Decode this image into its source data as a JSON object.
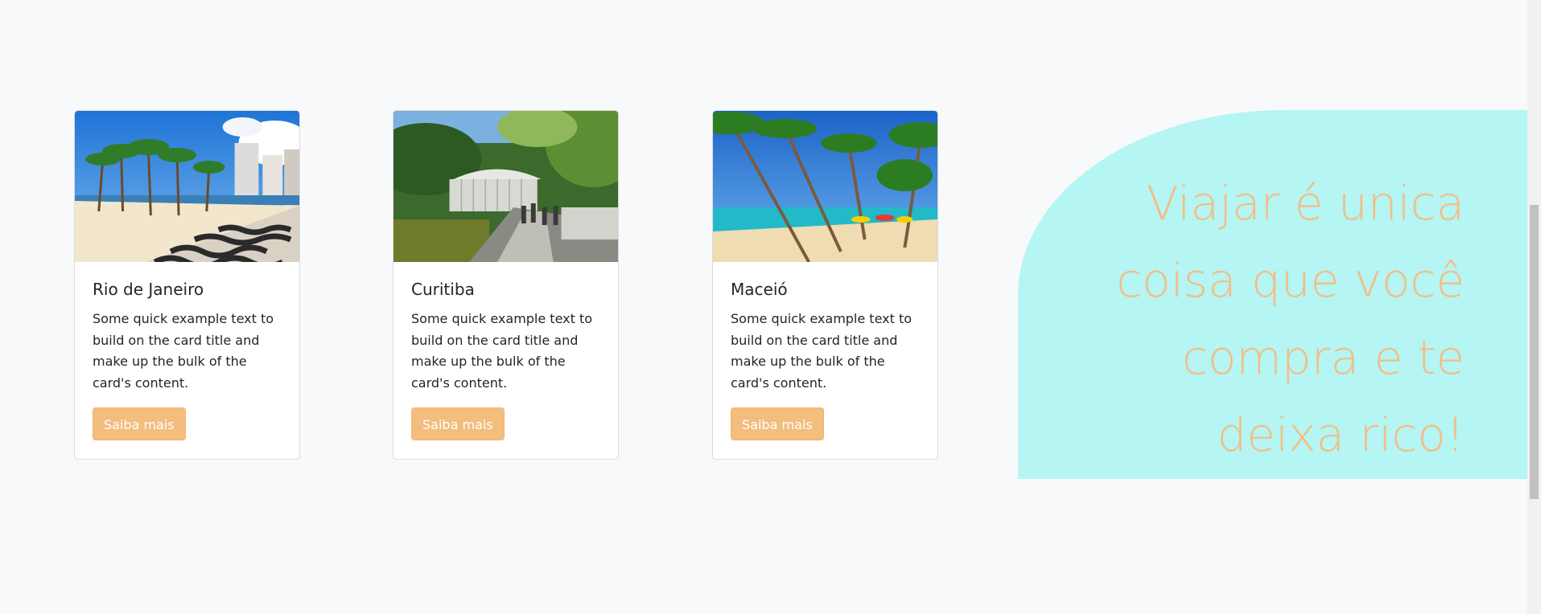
{
  "cards": [
    {
      "title": "Rio de Janeiro",
      "text": "Some quick example text to build on the card title and make up the bulk of the card's content.",
      "button_label": "Saiba mais",
      "image_alt": "Copacabana beach promenade with palm trees"
    },
    {
      "title": "Curitiba",
      "text": "Some quick example text to build on the card title and make up the bulk of the card's content.",
      "button_label": "Saiba mais",
      "image_alt": "Glass pavilion and bridge among forest"
    },
    {
      "title": "Maceió",
      "text": "Some quick example text to build on the card title and make up the bulk of the card's content.",
      "button_label": "Saiba mais",
      "image_alt": "Tropical beach with palm trees and umbrellas"
    }
  ],
  "hero": {
    "text": "Viajar é unica coisa que você compra e te deixa rico!"
  },
  "colors": {
    "page_bg": "#f8f9fa",
    "hero_bg": "#b5f5f3",
    "accent": "#f3bd7e"
  }
}
